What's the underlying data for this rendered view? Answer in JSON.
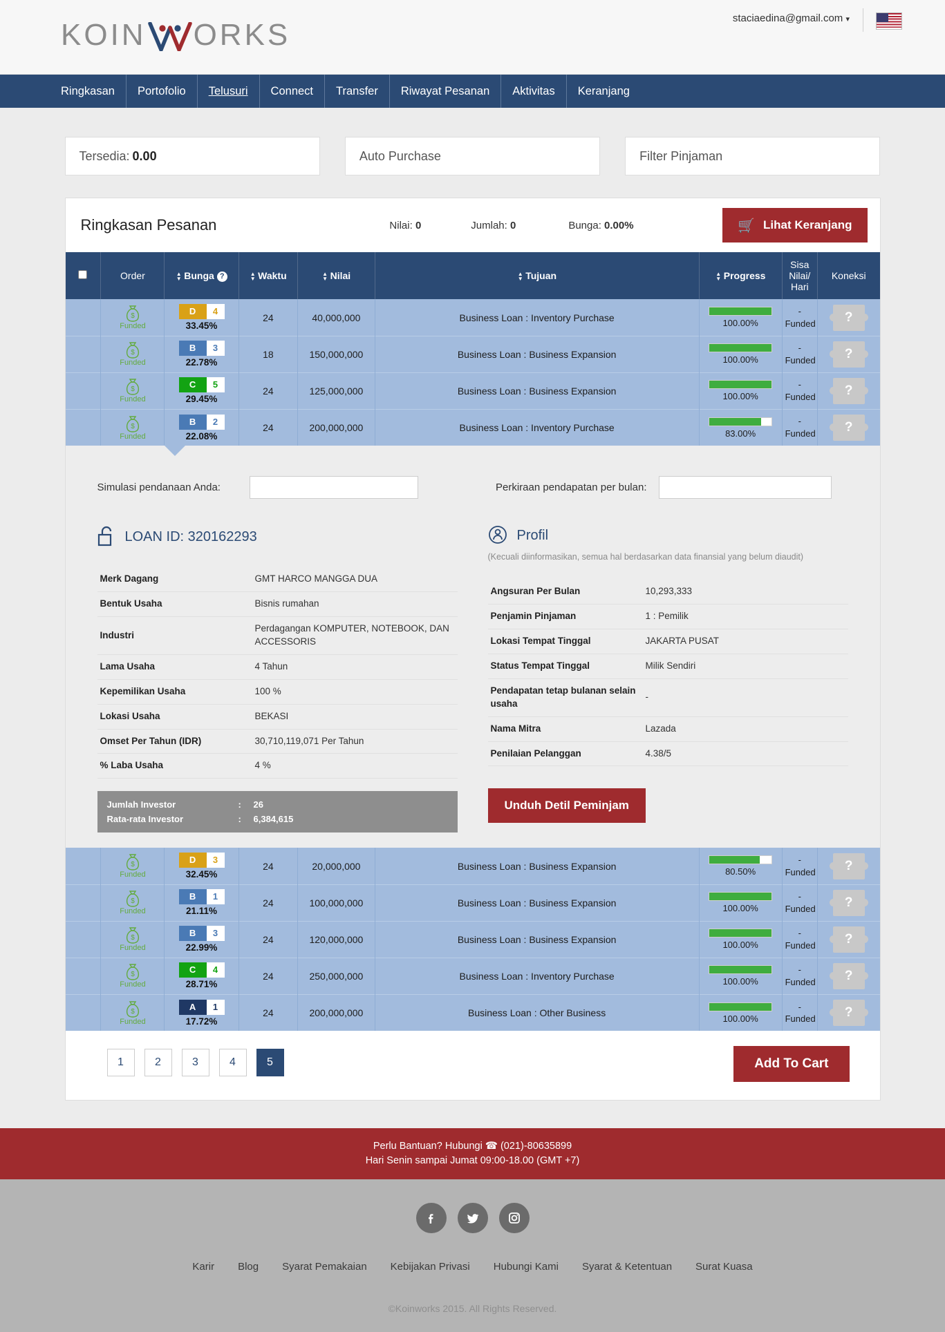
{
  "header": {
    "logo_text_left": "KOIN",
    "logo_text_right": "ORKS",
    "account_email": "staciaedina@gmail.com",
    "account_caret": "▾",
    "flag_name": "us-flag-icon"
  },
  "nav": {
    "items": [
      {
        "label": "Ringkasan",
        "active": false
      },
      {
        "label": "Portofolio",
        "active": false
      },
      {
        "label": "Telusuri",
        "active": true
      },
      {
        "label": "Connect",
        "active": false
      },
      {
        "label": "Transfer",
        "active": false
      },
      {
        "label": "Riwayat Pesanan",
        "active": false
      },
      {
        "label": "Aktivitas",
        "active": false
      },
      {
        "label": "Keranjang",
        "active": false
      }
    ]
  },
  "infoboxes": {
    "available_label": "Tersedia:",
    "available_value": "0.00",
    "auto_purchase": "Auto Purchase",
    "filter_loans": "Filter Pinjaman"
  },
  "summary": {
    "title": "Ringkasan Pesanan",
    "nilai_label": "Nilai:",
    "nilai_value": "0",
    "jumlah_label": "Jumlah:",
    "jumlah_value": "0",
    "bunga_label": "Bunga:",
    "bunga_value": "0.00%",
    "cart_button": "Lihat Keranjang",
    "cart_icon": "shopping-cart-icon"
  },
  "table": {
    "headers": {
      "checkbox": "",
      "order": "Order",
      "bunga": "Bunga",
      "waktu": "Waktu",
      "nilai": "Nilai",
      "tujuan": "Tujuan",
      "progress": "Progress",
      "sisa": "Sisa Nilai/ Hari",
      "sisa_l1": "Sisa",
      "sisa_l2": "Nilai/",
      "sisa_l3": "Hari",
      "koneksi": "Koneksi",
      "help_icon": "?"
    },
    "rows_top": [
      {
        "status": "Funded",
        "grade": "D",
        "grade_num": "4",
        "rate": "33.45%",
        "waktu": "24",
        "nilai": "40,000,000",
        "tujuan": "Business Loan : Inventory Purchase",
        "progress": 100,
        "progress_label": "100.00%",
        "sisa_l1": "-",
        "sisa_l2": "Funded",
        "koneksi": "?"
      },
      {
        "status": "Funded",
        "grade": "B",
        "grade_num": "3",
        "rate": "22.78%",
        "waktu": "18",
        "nilai": "150,000,000",
        "tujuan": "Business Loan : Business Expansion",
        "progress": 100,
        "progress_label": "100.00%",
        "sisa_l1": "-",
        "sisa_l2": "Funded",
        "koneksi": "?"
      },
      {
        "status": "Funded",
        "grade": "C",
        "grade_num": "5",
        "rate": "29.45%",
        "waktu": "24",
        "nilai": "125,000,000",
        "tujuan": "Business Loan : Business Expansion",
        "progress": 100,
        "progress_label": "100.00%",
        "sisa_l1": "-",
        "sisa_l2": "Funded",
        "koneksi": "?"
      },
      {
        "status": "Funded",
        "grade": "B",
        "grade_num": "2",
        "rate": "22.08%",
        "waktu": "24",
        "nilai": "200,000,000",
        "tujuan": "Business Loan : Inventory Purchase",
        "progress": 83,
        "progress_label": "83.00%",
        "sisa_l1": "-",
        "sisa_l2": "Funded",
        "koneksi": "?"
      }
    ],
    "rows_bottom": [
      {
        "status": "Funded",
        "grade": "D",
        "grade_num": "3",
        "rate": "32.45%",
        "waktu": "24",
        "nilai": "20,000,000",
        "tujuan": "Business Loan : Business Expansion",
        "progress": 80.5,
        "progress_label": "80.50%",
        "sisa_l1": "-",
        "sisa_l2": "Funded",
        "koneksi": "?"
      },
      {
        "status": "Funded",
        "grade": "B",
        "grade_num": "1",
        "rate": "21.11%",
        "waktu": "24",
        "nilai": "100,000,000",
        "tujuan": "Business Loan : Business Expansion",
        "progress": 100,
        "progress_label": "100.00%",
        "sisa_l1": "-",
        "sisa_l2": "Funded",
        "koneksi": "?"
      },
      {
        "status": "Funded",
        "grade": "B",
        "grade_num": "3",
        "rate": "22.99%",
        "waktu": "24",
        "nilai": "120,000,000",
        "tujuan": "Business Loan : Business Expansion",
        "progress": 100,
        "progress_label": "100.00%",
        "sisa_l1": "-",
        "sisa_l2": "Funded",
        "koneksi": "?"
      },
      {
        "status": "Funded",
        "grade": "C",
        "grade_num": "4",
        "rate": "28.71%",
        "waktu": "24",
        "nilai": "250,000,000",
        "tujuan": "Business Loan : Inventory Purchase",
        "progress": 100,
        "progress_label": "100.00%",
        "sisa_l1": "-",
        "sisa_l2": "Funded",
        "koneksi": "?"
      },
      {
        "status": "Funded",
        "grade": "A",
        "grade_num": "1",
        "rate": "17.72%",
        "waktu": "24",
        "nilai": "200,000,000",
        "tujuan": "Business Loan : Other Business",
        "progress": 100,
        "progress_label": "100.00%",
        "sisa_l1": "-",
        "sisa_l2": "Funded",
        "koneksi": "?"
      }
    ]
  },
  "detail": {
    "sim_label": "Simulasi pendanaan Anda:",
    "sim_value": "",
    "est_label": "Perkiraan pendapatan per bulan:",
    "est_value": "",
    "loan_id_label": "LOAN ID: 320162293",
    "lock_icon": "unlock-icon",
    "profile_title": "Profil",
    "profile_icon": "person-icon",
    "profile_note": "(Kecuali diinformasikan, semua hal berdasarkan data finansial yang belum diaudit)",
    "left_rows": [
      {
        "k": "Merk Dagang",
        "v": "GMT HARCO MANGGA DUA"
      },
      {
        "k": "Bentuk Usaha",
        "v": "Bisnis rumahan"
      },
      {
        "k": "Industri",
        "v": "Perdagangan KOMPUTER, NOTEBOOK, DAN ACCESSORIS"
      },
      {
        "k": "Lama Usaha",
        "v": "4 Tahun"
      },
      {
        "k": "Kepemilikan Usaha",
        "v": "100 %"
      },
      {
        "k": "Lokasi Usaha",
        "v": "BEKASI"
      },
      {
        "k": "Omset Per Tahun (IDR)",
        "v": "30,710,119,071 Per Tahun"
      },
      {
        "k": "% Laba Usaha",
        "v": "4 %"
      }
    ],
    "right_rows": [
      {
        "k": "Angsuran Per Bulan",
        "v": "10,293,333"
      },
      {
        "k": "Penjamin Pinjaman",
        "v": "1 : Pemilik"
      },
      {
        "k": "Lokasi Tempat Tinggal",
        "v": "JAKARTA PUSAT"
      },
      {
        "k": "Status Tempat Tinggal",
        "v": "Milik Sendiri"
      },
      {
        "k": "Pendapatan tetap bulanan selain usaha",
        "v": "-"
      },
      {
        "k": "Nama Mitra",
        "v": "Lazada"
      },
      {
        "k": "Penilaian Pelanggan",
        "v": "4.38/5"
      }
    ],
    "investor_count_label": "Jumlah Investor",
    "investor_count_sep": ":",
    "investor_count_value": "26",
    "investor_avg_label": "Rata-rata Investor",
    "investor_avg_sep": ":",
    "investor_avg_value": "6,384,615",
    "download_button": "Unduh Detil Peminjam"
  },
  "pagination": {
    "pages": [
      "1",
      "2",
      "3",
      "4",
      "5"
    ],
    "current": "5",
    "add_to_cart": "Add To Cart"
  },
  "footer": {
    "help_line1_pre": "Perlu Bantuan? Hubungi",
    "help_phone": "(021)-80635899",
    "phone_icon": "phone-icon",
    "help_line2": "Hari Senin sampai Jumat 09:00-18.00 (GMT +7)",
    "socials": [
      {
        "name": "facebook-icon",
        "glyph": "f"
      },
      {
        "name": "twitter-icon",
        "glyph": "t"
      },
      {
        "name": "instagram-icon",
        "glyph": "i"
      }
    ],
    "links": [
      "Karir",
      "Blog",
      "Syarat Pemakaian",
      "Kebijakan Privasi",
      "Hubungi Kami",
      "Syarat & Ketentuan",
      "Surat Kuasa"
    ],
    "copyright": "©Koinworks 2015. All Rights Reserved."
  },
  "colors": {
    "nav_blue": "#2b4a74",
    "row_blue": "#a2bbdd",
    "red": "#9f2b2e",
    "green": "#3fad3f",
    "grey": "#b4b4b4"
  }
}
